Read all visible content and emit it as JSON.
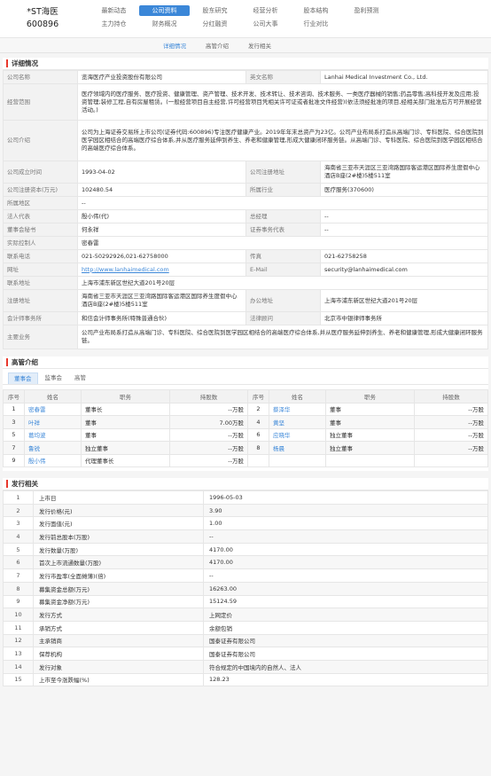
{
  "stock": {
    "name": "*ST海医",
    "code": "600896"
  },
  "nav": {
    "row1": [
      "最新动态",
      "公司资料",
      "股东研究",
      "经营分析",
      "股本结构",
      "盈利预测"
    ],
    "row2": [
      "主力持仓",
      "财务概况",
      "分红融资",
      "公司大事",
      "行业对比"
    ],
    "active": "公司资料"
  },
  "subnav": [
    "详细情况",
    "高管介绍",
    "发行相关"
  ],
  "details": {
    "title": "详细情况",
    "company_name_label": "公司名称",
    "company_name": "览海医疗产业投资股份有限公司",
    "english_name_label": "英文名称",
    "english_name": "Lanhai Medical Investment Co., Ltd.",
    "scope_label": "经营范围",
    "scope": "医疗领域内的医疗服务、医疗投资、健康管理、资产管理、技术开发、技术转让、技术咨询、技术服务、一类医疗器械的销售;药品零售;高科技开发及应用;投资管理;装修工程,自有房屋租赁。(一般经营项目自主经营,许可经营项目凭相关许可证或者批准文件经营)(依法须经批准的项目,经相关部门批准后方可开展经营活动。)",
    "intro_label": "公司介绍",
    "intro": "公司为上海证券交易所上市公司(证券代码:600896)专注医疗健康产业。2019年年末总资产为23亿。公司产业布局系打造从高端门诊、专科医院、综合医院到医学园区相结合的高端医疗综合体系,并从医疗服务延伸到养生、养老和健康管理,形成大健康闭环服务链。从高端门诊、专科医院、综合医院到医学园区相结合的高端医疗综合体系。",
    "founded_label": "公司成立时间",
    "founded": "1993-04-02",
    "reg_addr_label": "公司注册地址",
    "reg_addr": "海南省三亚市天涯区三亚湾路国际客运港区国际养生度假中心酒店B座(2#楼)5楼511室",
    "capital_label": "公司注册资本(万元)",
    "capital": "102480.54",
    "industry_label": "所属行业",
    "industry": "医疗服务(370600)",
    "region_label": "所属地区",
    "region": "--",
    "legal_rep_label": "法人代表",
    "legal_rep": "殷小伟(代)",
    "gm_label": "总经理",
    "gm": "--",
    "secretary_label": "董事会秘书",
    "secretary": "何永祥",
    "rep_label": "证券事务代表",
    "rep": "--",
    "controller_label": "实际控制人",
    "controller": "密春雷",
    "phone_label": "联系电话",
    "phone": "021-50292926,021-62758000",
    "fax_label": "传真",
    "fax": "021-62758258",
    "website_label": "网址",
    "website": "http://www.lanhaimedical.com",
    "email_label": "E-Mail",
    "email": "security@lanhaimedical.com",
    "contact_addr_label": "联系地址",
    "contact_addr": "上海市浦东新区世纪大道201号20层",
    "reg_addr2_label": "注册地址",
    "reg_addr2": "海南省三亚市天涯区三亚湾路国际客运港区国际养生度假中心酒店B座(2#楼)5楼511室",
    "office_label": "办公地址",
    "office": "上海市浦东新区世纪大道201号20层",
    "accounting_label": "会计师事务所",
    "accounting": "和信会计师事务所(特殊普通合伙)",
    "law_label": "法律顾问",
    "law": "北京市中银律师事务所",
    "business_label": "主要业务",
    "business": "公司产业布局系打造从高端门诊、专科医院、综合医院到医学园区相结合的高端医疗综合体系,并从医疗服务延伸到养生、养老和健康管理,形成大健康闭环服务链。"
  },
  "management": {
    "title": "高管介绍",
    "tabs": [
      "董事会",
      "监事会",
      "高管"
    ],
    "headers": [
      "序号",
      "姓名",
      "职务",
      "持股数",
      "序号",
      "姓名",
      "职务",
      "持股数"
    ],
    "rows": [
      [
        "1",
        "密春雷",
        "董事长",
        "--万股",
        "2",
        "蔡泽华",
        "董事",
        "--万股"
      ],
      [
        "3",
        "叶祥",
        "董事",
        "7.00万股",
        "4",
        "黄坚",
        "董事",
        "--万股"
      ],
      [
        "5",
        "葛均波",
        "董事",
        "--万股",
        "6",
        "应晓华",
        "独立董事",
        "--万股"
      ],
      [
        "7",
        "鲁锐",
        "独立董事",
        "--万股",
        "8",
        "杨晨",
        "独立董事",
        "--万股"
      ],
      [
        "9",
        "殷小伟",
        "代理董事长",
        "--万股",
        "",
        "",
        "",
        ""
      ]
    ]
  },
  "issuance": {
    "title": "发行相关",
    "rows": [
      [
        "1",
        "上市日",
        "1996-05-03"
      ],
      [
        "2",
        "发行价格(元)",
        "3.90"
      ],
      [
        "3",
        "发行面值(元)",
        "1.00"
      ],
      [
        "4",
        "发行前总股本(万股)",
        "--"
      ],
      [
        "5",
        "发行数量(万股)",
        "4170.00"
      ],
      [
        "6",
        "首次上市流通数量(万股)",
        "4170.00"
      ],
      [
        "7",
        "发行市盈率(全面摊薄)(倍)",
        "--"
      ],
      [
        "8",
        "募集资金总额(万元)",
        "16263.00"
      ],
      [
        "9",
        "募集资金净额(万元)",
        "15124.59"
      ],
      [
        "10",
        "发行方式",
        "上网定价"
      ],
      [
        "11",
        "承销方式",
        "余额包销"
      ],
      [
        "12",
        "主承销商",
        "国泰证券有限公司"
      ],
      [
        "13",
        "保荐机构",
        "国泰证券有限公司"
      ],
      [
        "14",
        "发行对象",
        "符合规定的中国境内的自然人、法人"
      ],
      [
        "15",
        "上市至今涨跌幅(%)",
        "128.23"
      ]
    ]
  }
}
